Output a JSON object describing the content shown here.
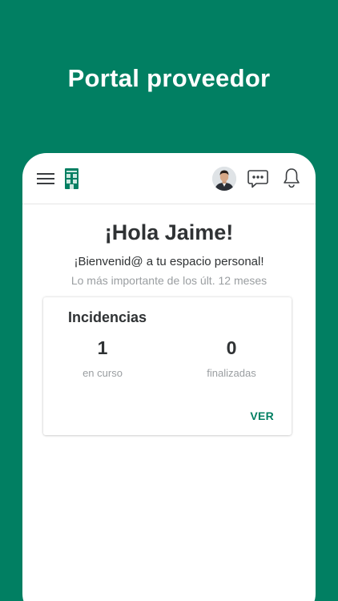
{
  "promo": {
    "title": "Portal proveedor"
  },
  "app": {
    "topbar": {
      "icons": [
        "menu-icon",
        "building-logo-icon",
        "avatar",
        "chat-icon",
        "bell-icon"
      ]
    },
    "greeting": "¡Hola Jaime!",
    "welcome": "¡Bienvenid@ a tu espacio personal!",
    "subtitle": "Lo más importante de los últ. 12 meses",
    "incidents_card": {
      "title": "Incidencias",
      "stats": [
        {
          "value": "1",
          "label": "en curso"
        },
        {
          "value": "0",
          "label": "finalizadas"
        }
      ],
      "action_label": "VER"
    }
  },
  "colors": {
    "brand_green": "#017f62",
    "text_dark": "#2f3234",
    "text_muted": "#9a9ea1"
  }
}
